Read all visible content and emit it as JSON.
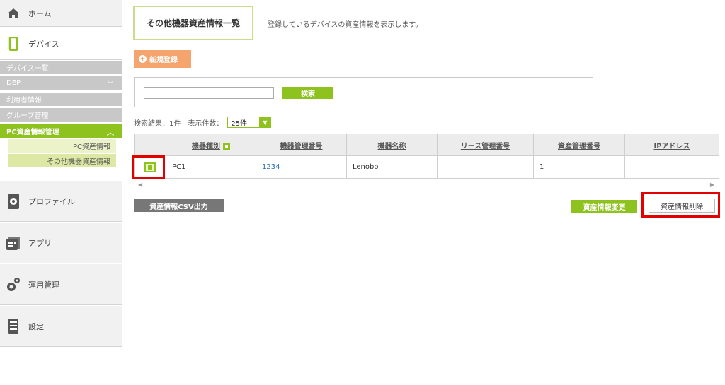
{
  "sidebar": {
    "home": "ホーム",
    "device": "デバイス",
    "sub_items": [
      {
        "label": "デバイス一覧"
      },
      {
        "label": "DEP"
      },
      {
        "label": "利用者情報"
      },
      {
        "label": "グループ管理"
      },
      {
        "label": "PC資産情報管理"
      }
    ],
    "pc_children": [
      {
        "label": "PC資産情報"
      },
      {
        "label": "その他機器資産情報"
      }
    ],
    "profile": "プロファイル",
    "app": "アプリ",
    "operations": "運用管理",
    "settings": "設定"
  },
  "main": {
    "title": "その他機器資産情報一覧",
    "description": "登録しているデバイスの資産情報を表示します。",
    "new_button": "新規登録",
    "search_button": "検索",
    "search_value": "",
    "result_label": "検索結果：1件　表示件数：",
    "per_page": "25件"
  },
  "table": {
    "headers": [
      "機器種別",
      "機器管理番号",
      "機器名称",
      "リース管理番号",
      "資産管理番号",
      "IPアドレス"
    ],
    "rows": [
      {
        "type": "PC1",
        "device_no": "1234",
        "name": "Lenobo",
        "lease_no": "",
        "asset_no": "1",
        "ip": ""
      }
    ]
  },
  "actions": {
    "csv": "資産情報CSV出力",
    "change": "資産情報変更",
    "delete": "資産情報削除"
  },
  "colors": {
    "accent": "#8dc21f",
    "orange": "#f4a46c",
    "highlight": "#e30000"
  }
}
